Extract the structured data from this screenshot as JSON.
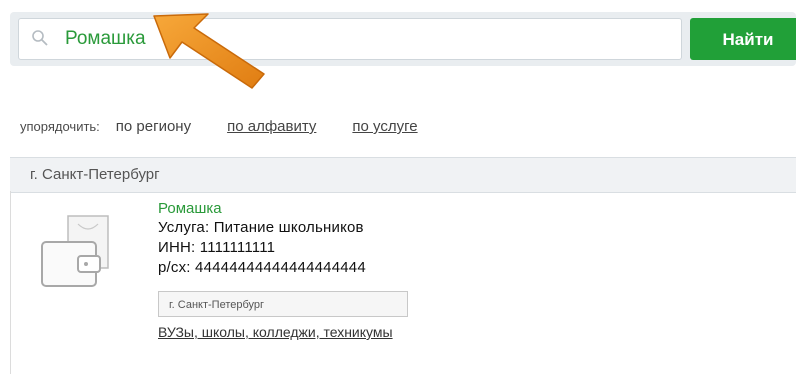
{
  "search": {
    "value": "Ромашка",
    "button_label": "Найти"
  },
  "sort": {
    "label": "упорядочить:",
    "options": [
      "по региону",
      "по алфавиту",
      "по услуге"
    ]
  },
  "region": {
    "title": "г. Санкт-Петербург"
  },
  "result": {
    "name": "Ромашка",
    "service": "Услуга: Питание школьников",
    "inn": "ИНН: 1111111111",
    "account": "р/сх: 44444444444444444444",
    "region_tag": "г. Санкт-Петербург",
    "category": "ВУЗы, школы, колледжи, техникумы"
  },
  "colors": {
    "accent_green": "#21a038",
    "annotation_arrow": "#f0921e"
  }
}
